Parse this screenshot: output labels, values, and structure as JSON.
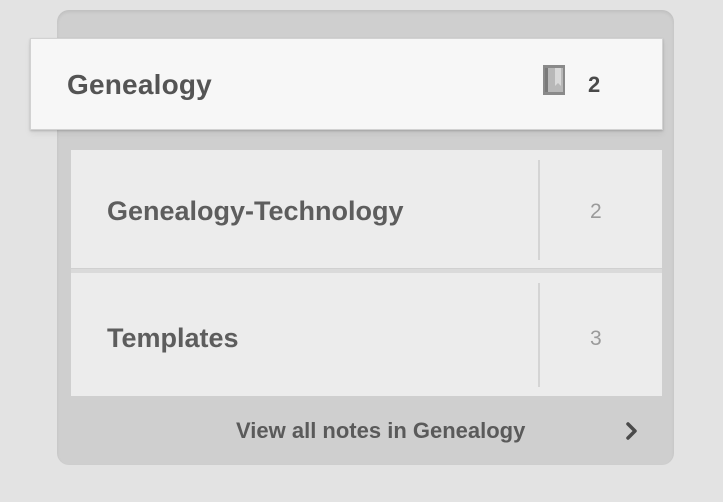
{
  "stack": {
    "title": "Genealogy",
    "count": "2",
    "icon": "notebook-icon"
  },
  "notebooks": [
    {
      "name": "Genealogy-Technology",
      "count": "2"
    },
    {
      "name": "Templates",
      "count": "3"
    }
  ],
  "footer": {
    "view_all_label": "View all notes in Genealogy",
    "icon": "chevron-right-icon"
  }
}
